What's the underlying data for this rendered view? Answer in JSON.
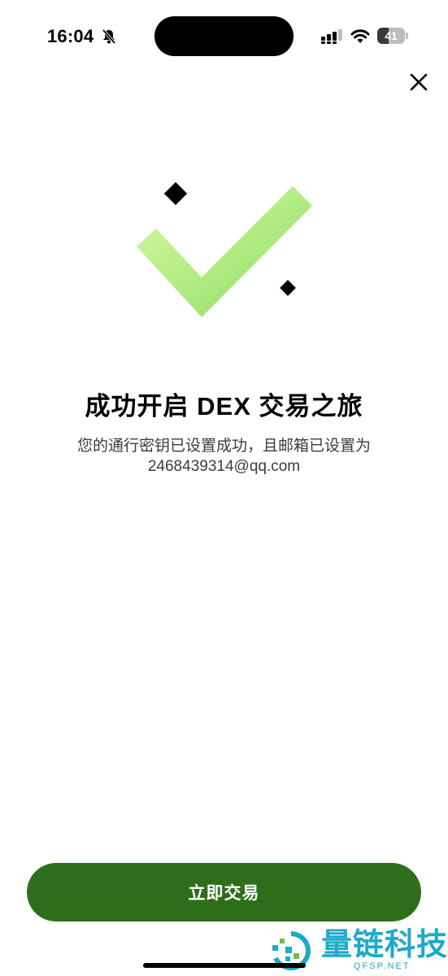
{
  "status_bar": {
    "time": "16:04",
    "battery_level": "41",
    "icons": [
      "bell-muted-icon",
      "cellular-signal-icon",
      "wifi-icon",
      "battery-icon"
    ]
  },
  "close_icon": "close-icon",
  "hero_icon": "success-checkmark-icon",
  "colors": {
    "primary_button": "#2e6e1a",
    "check_gradient_start": "#d4f59a",
    "check_gradient_end": "#8fe06a",
    "watermark": "#1ea9c9"
  },
  "success": {
    "title": "成功开启 DEX 交易之旅",
    "description_line1": "您的通行密钥已设置成功，且邮箱已设置为",
    "description_line2": "2468439314@qq.com"
  },
  "primary_button": {
    "label": "立即交易"
  },
  "watermark": {
    "text": "量链科技",
    "sub": "QFSP.NET"
  }
}
